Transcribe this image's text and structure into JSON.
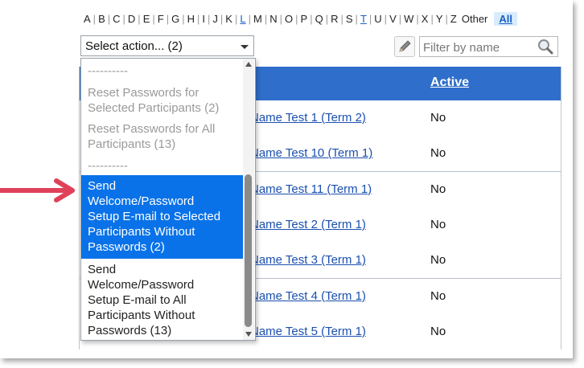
{
  "alphabet": {
    "letters": [
      "A",
      "B",
      "C",
      "D",
      "E",
      "F",
      "G",
      "H",
      "I",
      "J",
      "K",
      "L",
      "M",
      "N",
      "O",
      "P",
      "Q",
      "R",
      "S",
      "T",
      "U",
      "V",
      "W",
      "X",
      "Y",
      "Z"
    ],
    "linked": [
      "L",
      "T"
    ],
    "other_label": "Other",
    "all_label": "All"
  },
  "action_select": {
    "value": "Select action... (2)"
  },
  "filter": {
    "placeholder": "Filter by name"
  },
  "table": {
    "header_active": "Active",
    "rows": [
      {
        "name": "Name Test 1 (Term 2)",
        "active": "No"
      },
      {
        "name": "Name Test 10 (Term 1)",
        "active": "No"
      },
      {
        "name": "Name Test 11 (Term 1)",
        "active": "No"
      },
      {
        "name": "Name Test 2 (Term 1)",
        "active": "No"
      },
      {
        "name": "Name Test 3 (Term 1)",
        "active": "No"
      },
      {
        "name": "Name Test 4 (Term 1)",
        "active": "No"
      },
      {
        "name": "Name Test 5 (Term 1)",
        "active": "No"
      }
    ]
  },
  "dropdown": {
    "options": [
      {
        "lines": [
          "----------"
        ],
        "state": "disabled"
      },
      {
        "lines": [
          "Reset Passwords for",
          "Selected Participants (2)"
        ],
        "state": "disabled"
      },
      {
        "lines": [
          "Reset Passwords for All",
          "Participants (13)"
        ],
        "state": "disabled"
      },
      {
        "lines": [
          "----------"
        ],
        "state": "disabled"
      },
      {
        "lines": [
          "Send",
          "Welcome/Password",
          "Setup E-mail to Selected",
          "Participants Without",
          "Passwords (2)"
        ],
        "state": "selected"
      },
      {
        "lines": [
          "Send",
          "Welcome/Password",
          "Setup E-mail to All",
          "Participants Without",
          "Passwords (13)"
        ],
        "state": "normal"
      }
    ]
  },
  "colors": {
    "header_blue": "#2f6fcb",
    "selected_blue": "#0a72e8",
    "arrow_red": "#e0415a",
    "link_blue": "#1a4fb0"
  },
  "icons": [
    "pencil-icon",
    "search-icon",
    "chevron-down-icon",
    "arrow-annotation"
  ]
}
